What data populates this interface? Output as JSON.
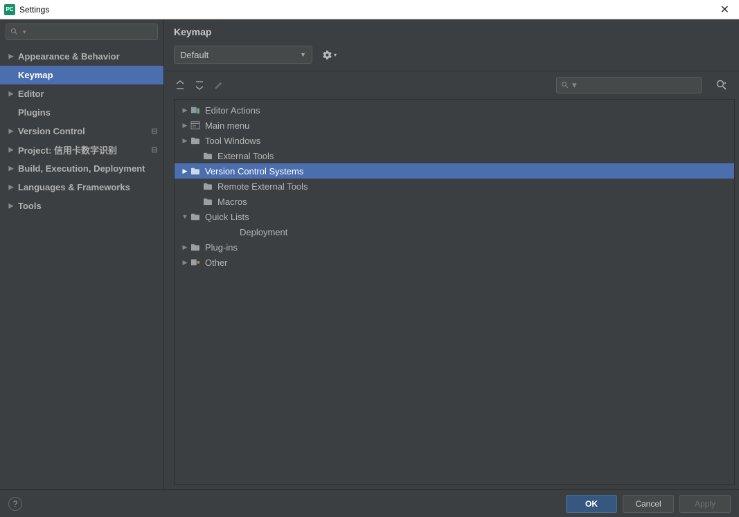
{
  "window": {
    "title": "Settings"
  },
  "sidebar": {
    "items": [
      {
        "label": "Appearance & Behavior",
        "expandable": true
      },
      {
        "label": "Keymap",
        "child": true,
        "selected": true
      },
      {
        "label": "Editor",
        "expandable": true
      },
      {
        "label": "Plugins",
        "child": true
      },
      {
        "label": "Version Control",
        "expandable": true,
        "proj": true
      },
      {
        "label": "Project: 信用卡数字识别",
        "expandable": true,
        "proj": true
      },
      {
        "label": "Build, Execution, Deployment",
        "expandable": true
      },
      {
        "label": "Languages & Frameworks",
        "expandable": true
      },
      {
        "label": "Tools",
        "expandable": true
      }
    ]
  },
  "main": {
    "title": "Keymap",
    "keymap_select": "Default",
    "tree": [
      {
        "label": "Editor Actions",
        "depth": 0,
        "arrow": "▶",
        "iconType": "editor"
      },
      {
        "label": "Main menu",
        "depth": 0,
        "arrow": "▶",
        "iconType": "menu"
      },
      {
        "label": "Tool Windows",
        "depth": 0,
        "arrow": "▶",
        "iconType": "folder"
      },
      {
        "label": "External Tools",
        "depth": 1,
        "arrow": "",
        "iconType": "folder"
      },
      {
        "label": "Version Control Systems",
        "depth": 0,
        "arrow": "▶",
        "iconType": "folder",
        "selected": true
      },
      {
        "label": "Remote External Tools",
        "depth": 1,
        "arrow": "",
        "iconType": "folder"
      },
      {
        "label": "Macros",
        "depth": 1,
        "arrow": "",
        "iconType": "folder"
      },
      {
        "label": "Quick Lists",
        "depth": 0,
        "arrow": "▼",
        "iconType": "folder"
      },
      {
        "label": "Deployment",
        "depth": 2,
        "arrow": "",
        "iconType": "none"
      },
      {
        "label": "Plug-ins",
        "depth": 0,
        "arrow": "▶",
        "iconType": "folder"
      },
      {
        "label": "Other",
        "depth": 0,
        "arrow": "▶",
        "iconType": "other"
      }
    ]
  },
  "footer": {
    "ok": "OK",
    "cancel": "Cancel",
    "apply": "Apply"
  }
}
